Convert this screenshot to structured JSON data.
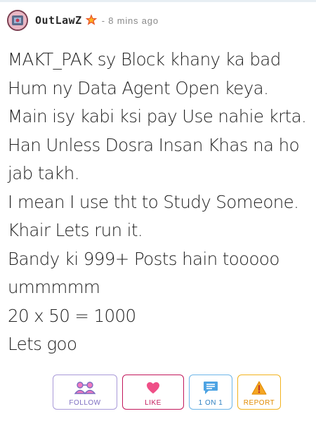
{
  "author": {
    "name": "OutLawZ",
    "time": "- 8 mins ago",
    "avatar_icon": "avatar-image",
    "badge_icon": "star-icon",
    "badge_color": "#e8562a"
  },
  "post": {
    "lines": [
      "MAKT_PAK sy Block khany ka bad",
      "Hum ny Data Agent Open keya.",
      "Main isy kabi ksi pay Use nahie krta.",
      "Han Unless Dosra Insan Khas na ho",
      "jab takh.",
      "I mean I use tht to Study Someone.",
      "Khair Lets run it.",
      "Bandy ki 999+ Posts hain tooooo",
      "ummmmm",
      "20 x 50 = 1000",
      "Lets goo"
    ]
  },
  "actions": {
    "follow": {
      "label": "FOLLOW",
      "icon": "people-icon",
      "color": "#7c6cc0"
    },
    "like": {
      "label": "LIKE",
      "icon": "heart-icon",
      "color": "#c2185b"
    },
    "one_on_one": {
      "label": "1 ON 1",
      "icon": "chat-icon",
      "color": "#2d7fc1"
    },
    "report": {
      "label": "REPORT",
      "icon": "warning-icon",
      "color": "#e08a00"
    }
  }
}
